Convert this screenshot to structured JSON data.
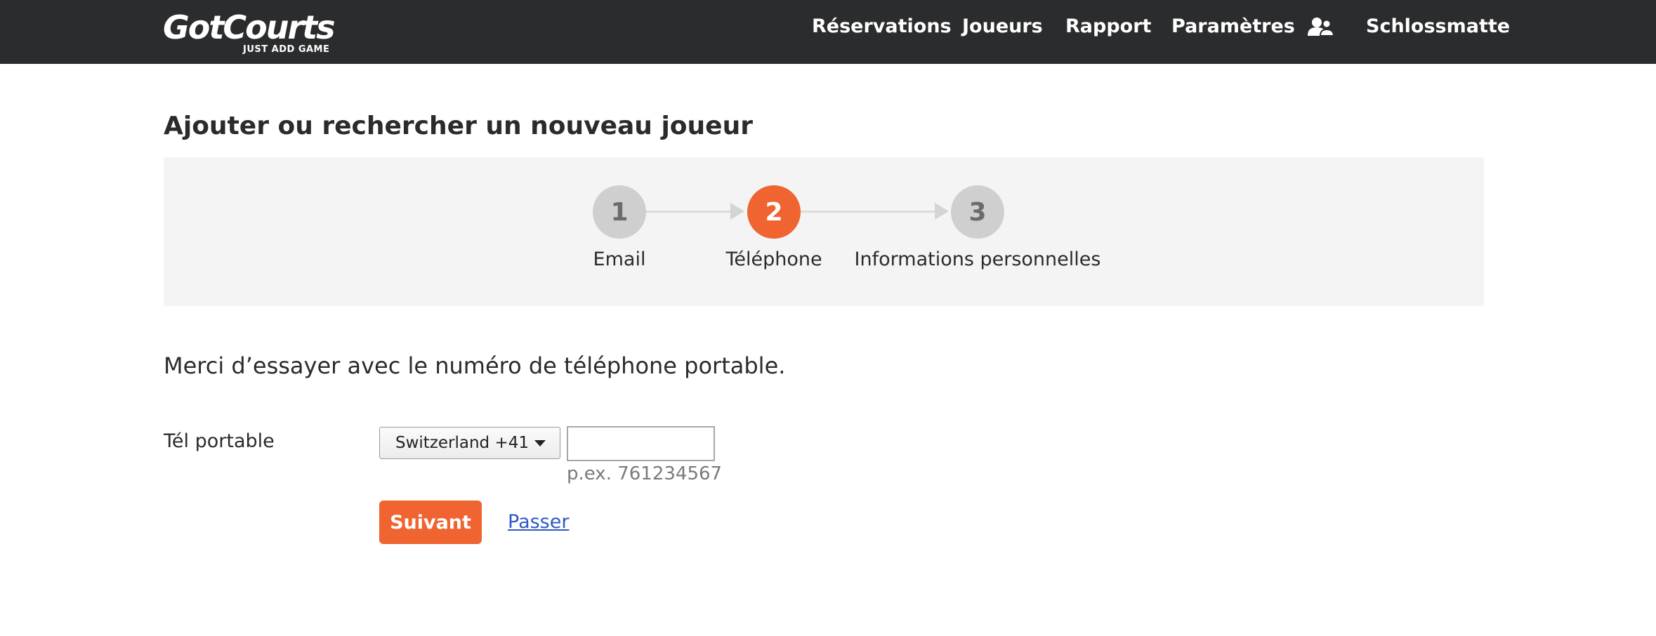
{
  "brand": {
    "name": "GotCourts",
    "tagline": "JUST ADD GAME"
  },
  "nav": {
    "items": [
      "Réservations",
      "Joueurs",
      "Rapport",
      "Paramètres"
    ],
    "users_icon": "users-icon",
    "club": "Schlossmatte"
  },
  "page": {
    "title": "Ajouter ou rechercher un nouveau joueur"
  },
  "stepper": {
    "active_step": 2,
    "steps": [
      {
        "number": "1",
        "label": "Email"
      },
      {
        "number": "2",
        "label": "Téléphone"
      },
      {
        "number": "3",
        "label": "Informations personnelles"
      }
    ]
  },
  "form": {
    "message": "Merci d’essayer avec le numéro de téléphone portable.",
    "phone_label": "Tél portable",
    "country_value": "Switzerland +41",
    "phone_value": "",
    "phone_hint": "p.ex. 761234567",
    "next_label": "Suivant",
    "skip_label": "Passer"
  },
  "colors": {
    "topbar": "#2b2c2e",
    "accent": "#ef6430",
    "step_inactive": "#cfcfcf",
    "stepper_bg": "#f4f4f4",
    "link": "#2f57c8"
  }
}
